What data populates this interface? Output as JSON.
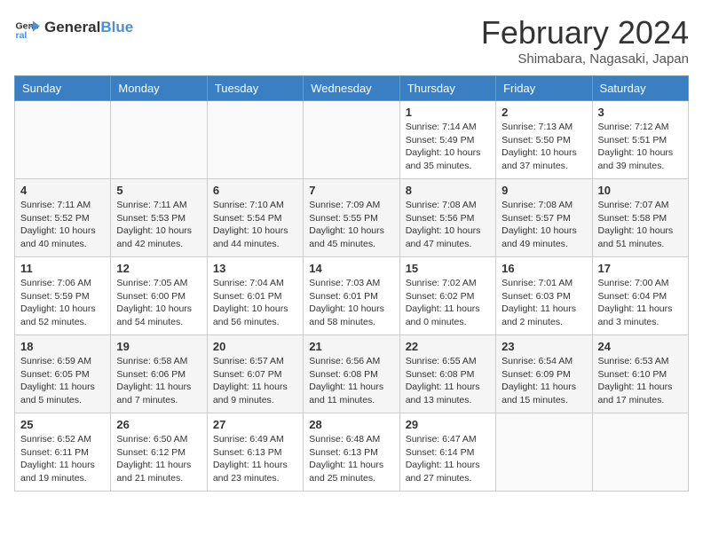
{
  "logo": {
    "text_general": "General",
    "text_blue": "Blue"
  },
  "header": {
    "title": "February 2024",
    "subtitle": "Shimabara, Nagasaki, Japan"
  },
  "weekdays": [
    "Sunday",
    "Monday",
    "Tuesday",
    "Wednesday",
    "Thursday",
    "Friday",
    "Saturday"
  ],
  "weeks": [
    [
      {
        "day": "",
        "info": ""
      },
      {
        "day": "",
        "info": ""
      },
      {
        "day": "",
        "info": ""
      },
      {
        "day": "",
        "info": ""
      },
      {
        "day": "1",
        "info": "Sunrise: 7:14 AM\nSunset: 5:49 PM\nDaylight: 10 hours\nand 35 minutes."
      },
      {
        "day": "2",
        "info": "Sunrise: 7:13 AM\nSunset: 5:50 PM\nDaylight: 10 hours\nand 37 minutes."
      },
      {
        "day": "3",
        "info": "Sunrise: 7:12 AM\nSunset: 5:51 PM\nDaylight: 10 hours\nand 39 minutes."
      }
    ],
    [
      {
        "day": "4",
        "info": "Sunrise: 7:11 AM\nSunset: 5:52 PM\nDaylight: 10 hours\nand 40 minutes."
      },
      {
        "day": "5",
        "info": "Sunrise: 7:11 AM\nSunset: 5:53 PM\nDaylight: 10 hours\nand 42 minutes."
      },
      {
        "day": "6",
        "info": "Sunrise: 7:10 AM\nSunset: 5:54 PM\nDaylight: 10 hours\nand 44 minutes."
      },
      {
        "day": "7",
        "info": "Sunrise: 7:09 AM\nSunset: 5:55 PM\nDaylight: 10 hours\nand 45 minutes."
      },
      {
        "day": "8",
        "info": "Sunrise: 7:08 AM\nSunset: 5:56 PM\nDaylight: 10 hours\nand 47 minutes."
      },
      {
        "day": "9",
        "info": "Sunrise: 7:08 AM\nSunset: 5:57 PM\nDaylight: 10 hours\nand 49 minutes."
      },
      {
        "day": "10",
        "info": "Sunrise: 7:07 AM\nSunset: 5:58 PM\nDaylight: 10 hours\nand 51 minutes."
      }
    ],
    [
      {
        "day": "11",
        "info": "Sunrise: 7:06 AM\nSunset: 5:59 PM\nDaylight: 10 hours\nand 52 minutes."
      },
      {
        "day": "12",
        "info": "Sunrise: 7:05 AM\nSunset: 6:00 PM\nDaylight: 10 hours\nand 54 minutes."
      },
      {
        "day": "13",
        "info": "Sunrise: 7:04 AM\nSunset: 6:01 PM\nDaylight: 10 hours\nand 56 minutes."
      },
      {
        "day": "14",
        "info": "Sunrise: 7:03 AM\nSunset: 6:01 PM\nDaylight: 10 hours\nand 58 minutes."
      },
      {
        "day": "15",
        "info": "Sunrise: 7:02 AM\nSunset: 6:02 PM\nDaylight: 11 hours\nand 0 minutes."
      },
      {
        "day": "16",
        "info": "Sunrise: 7:01 AM\nSunset: 6:03 PM\nDaylight: 11 hours\nand 2 minutes."
      },
      {
        "day": "17",
        "info": "Sunrise: 7:00 AM\nSunset: 6:04 PM\nDaylight: 11 hours\nand 3 minutes."
      }
    ],
    [
      {
        "day": "18",
        "info": "Sunrise: 6:59 AM\nSunset: 6:05 PM\nDaylight: 11 hours\nand 5 minutes."
      },
      {
        "day": "19",
        "info": "Sunrise: 6:58 AM\nSunset: 6:06 PM\nDaylight: 11 hours\nand 7 minutes."
      },
      {
        "day": "20",
        "info": "Sunrise: 6:57 AM\nSunset: 6:07 PM\nDaylight: 11 hours\nand 9 minutes."
      },
      {
        "day": "21",
        "info": "Sunrise: 6:56 AM\nSunset: 6:08 PM\nDaylight: 11 hours\nand 11 minutes."
      },
      {
        "day": "22",
        "info": "Sunrise: 6:55 AM\nSunset: 6:08 PM\nDaylight: 11 hours\nand 13 minutes."
      },
      {
        "day": "23",
        "info": "Sunrise: 6:54 AM\nSunset: 6:09 PM\nDaylight: 11 hours\nand 15 minutes."
      },
      {
        "day": "24",
        "info": "Sunrise: 6:53 AM\nSunset: 6:10 PM\nDaylight: 11 hours\nand 17 minutes."
      }
    ],
    [
      {
        "day": "25",
        "info": "Sunrise: 6:52 AM\nSunset: 6:11 PM\nDaylight: 11 hours\nand 19 minutes."
      },
      {
        "day": "26",
        "info": "Sunrise: 6:50 AM\nSunset: 6:12 PM\nDaylight: 11 hours\nand 21 minutes."
      },
      {
        "day": "27",
        "info": "Sunrise: 6:49 AM\nSunset: 6:13 PM\nDaylight: 11 hours\nand 23 minutes."
      },
      {
        "day": "28",
        "info": "Sunrise: 6:48 AM\nSunset: 6:13 PM\nDaylight: 11 hours\nand 25 minutes."
      },
      {
        "day": "29",
        "info": "Sunrise: 6:47 AM\nSunset: 6:14 PM\nDaylight: 11 hours\nand 27 minutes."
      },
      {
        "day": "",
        "info": ""
      },
      {
        "day": "",
        "info": ""
      }
    ]
  ]
}
